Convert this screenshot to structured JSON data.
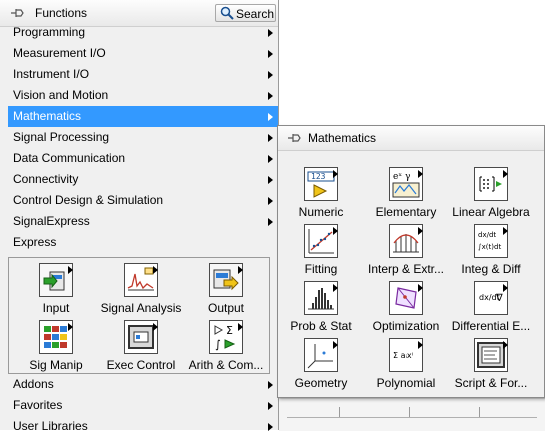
{
  "functions_palette": {
    "title": "Functions",
    "search_label": "Search",
    "menu_items": [
      {
        "label": "Programming",
        "has_submenu": true
      },
      {
        "label": "Measurement I/O",
        "has_submenu": true
      },
      {
        "label": "Instrument I/O",
        "has_submenu": true
      },
      {
        "label": "Vision and Motion",
        "has_submenu": true
      },
      {
        "label": "Mathematics",
        "has_submenu": true,
        "selected": true
      },
      {
        "label": "Signal Processing",
        "has_submenu": true
      },
      {
        "label": "Data Communication",
        "has_submenu": true
      },
      {
        "label": "Connectivity",
        "has_submenu": true
      },
      {
        "label": "Control Design & Simulation",
        "has_submenu": true
      },
      {
        "label": "SignalExpress",
        "has_submenu": true
      },
      {
        "label": "Express",
        "has_submenu": false
      }
    ],
    "express_tiles": [
      {
        "label": "Input",
        "icon": "input-icon"
      },
      {
        "label": "Signal Analysis",
        "icon": "signal-analysis-icon"
      },
      {
        "label": "Output",
        "icon": "output-icon"
      },
      {
        "label": "Sig Manip",
        "icon": "sig-manip-icon"
      },
      {
        "label": "Exec Control",
        "icon": "exec-control-icon"
      },
      {
        "label": "Arith & Com...",
        "icon": "arith-comparison-icon"
      }
    ],
    "menu_items_bottom": [
      {
        "label": "Addons",
        "has_submenu": true
      },
      {
        "label": "Favorites",
        "has_submenu": true
      },
      {
        "label": "User Libraries",
        "has_submenu": true
      }
    ]
  },
  "math_palette": {
    "title": "Mathematics",
    "tiles": [
      {
        "label": "Numeric",
        "icon": "numeric-icon"
      },
      {
        "label": "Elementary",
        "icon": "elementary-icon"
      },
      {
        "label": "Linear Algebra",
        "icon": "linear-algebra-icon"
      },
      {
        "label": "Fitting",
        "icon": "fitting-icon"
      },
      {
        "label": "Interp & Extr...",
        "icon": "interp-extrap-icon"
      },
      {
        "label": "Integ & Diff",
        "icon": "integ-diff-icon"
      },
      {
        "label": "Prob & Stat",
        "icon": "prob-stat-icon"
      },
      {
        "label": "Optimization",
        "icon": "optimization-icon"
      },
      {
        "label": "Differential E...",
        "icon": "differential-eq-icon"
      },
      {
        "label": "Geometry",
        "icon": "geometry-icon"
      },
      {
        "label": "Polynomial",
        "icon": "polynomial-icon"
      },
      {
        "label": "Script & For...",
        "icon": "script-formula-icon"
      }
    ],
    "icon_text": {
      "numeric_display": "123",
      "elementary": "eˣ γ",
      "integ_top": "dx/dt",
      "integ_bottom": "∫x(t)dt",
      "diff_eq": "dx/dt",
      "arith": "▷ Σ",
      "polynomial": "Σ aᵢxⁱ"
    }
  },
  "colors": {
    "selection": "#3399ff",
    "palette_bg": "#f0f0f0"
  }
}
